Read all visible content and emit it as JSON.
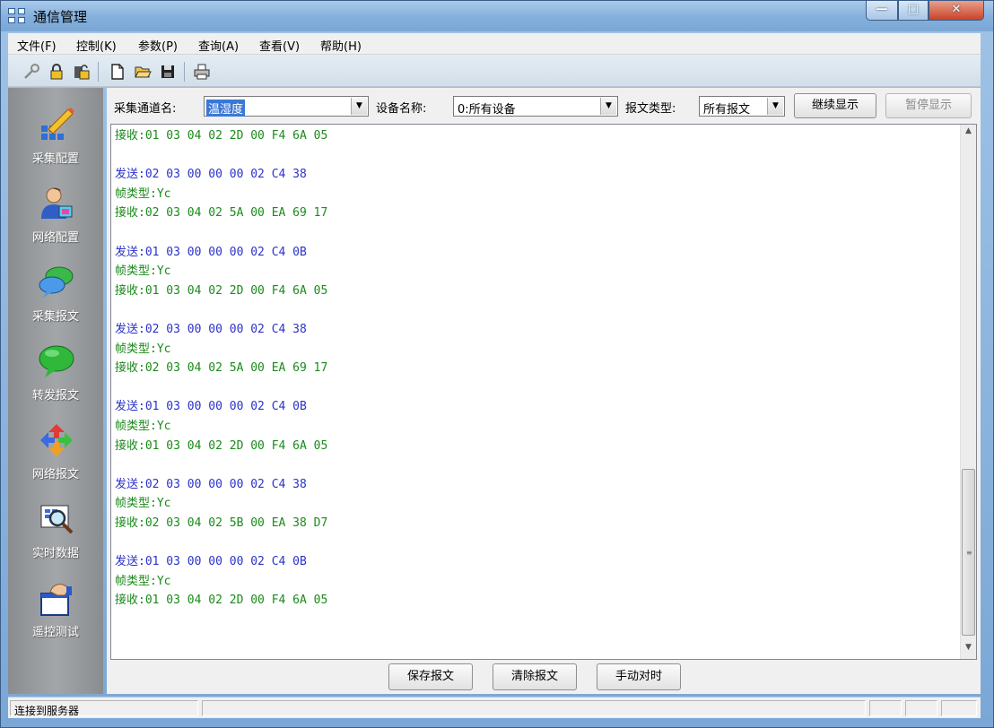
{
  "window": {
    "title": "通信管理"
  },
  "menu": [
    {
      "label": "文件(F)"
    },
    {
      "label": "控制(K)"
    },
    {
      "label": "参数(P)"
    },
    {
      "label": "查询(A)"
    },
    {
      "label": "查看(V)"
    },
    {
      "label": "帮助(H)"
    }
  ],
  "toolbar": {
    "icons": [
      "key-icon",
      "lock-icon",
      "unlock-icon",
      "new-file-icon",
      "open-folder-icon",
      "save-icon",
      "print-icon"
    ]
  },
  "sidebar": {
    "items": [
      {
        "label": "采集配置",
        "icon": "collect-config-icon"
      },
      {
        "label": "网络配置",
        "icon": "network-config-icon"
      },
      {
        "label": "采集报文",
        "icon": "collect-message-icon"
      },
      {
        "label": "转发报文",
        "icon": "forward-message-icon"
      },
      {
        "label": "网络报文",
        "icon": "network-message-icon"
      },
      {
        "label": "实时数据",
        "icon": "realtime-data-icon"
      },
      {
        "label": "遥控测试",
        "icon": "remote-control-icon"
      }
    ]
  },
  "filters": {
    "channel_label": "采集通道名:",
    "channel_value": "温湿度",
    "device_label": "设备名称:",
    "device_value": "0:所有设备",
    "type_label": "报文类型:",
    "type_value": "所有报文",
    "continue_button": "继续显示",
    "pause_button": "暂停显示"
  },
  "log": {
    "lines": [
      {
        "kind": "recv",
        "text": "接收:01 03 04 02 2D 00 F4 6A 05"
      },
      {
        "kind": "blank",
        "text": ""
      },
      {
        "kind": "send",
        "text": "发送:02 03 00 00 00 02 C4 38"
      },
      {
        "kind": "frame",
        "text": "帧类型:Yc"
      },
      {
        "kind": "recv",
        "text": "接收:02 03 04 02 5A 00 EA 69 17"
      },
      {
        "kind": "blank",
        "text": ""
      },
      {
        "kind": "send",
        "text": "发送:01 03 00 00 00 02 C4 0B"
      },
      {
        "kind": "frame",
        "text": "帧类型:Yc"
      },
      {
        "kind": "recv",
        "text": "接收:01 03 04 02 2D 00 F4 6A 05"
      },
      {
        "kind": "blank",
        "text": ""
      },
      {
        "kind": "send",
        "text": "发送:02 03 00 00 00 02 C4 38"
      },
      {
        "kind": "frame",
        "text": "帧类型:Yc"
      },
      {
        "kind": "recv",
        "text": "接收:02 03 04 02 5A 00 EA 69 17"
      },
      {
        "kind": "blank",
        "text": ""
      },
      {
        "kind": "send",
        "text": "发送:01 03 00 00 00 02 C4 0B"
      },
      {
        "kind": "frame",
        "text": "帧类型:Yc"
      },
      {
        "kind": "recv",
        "text": "接收:01 03 04 02 2D 00 F4 6A 05"
      },
      {
        "kind": "blank",
        "text": ""
      },
      {
        "kind": "send",
        "text": "发送:02 03 00 00 00 02 C4 38"
      },
      {
        "kind": "frame",
        "text": "帧类型:Yc"
      },
      {
        "kind": "recv",
        "text": "接收:02 03 04 02 5B 00 EA 38 D7"
      },
      {
        "kind": "blank",
        "text": ""
      },
      {
        "kind": "send",
        "text": "发送:01 03 00 00 00 02 C4 0B"
      },
      {
        "kind": "frame",
        "text": "帧类型:Yc"
      },
      {
        "kind": "recv",
        "text": "接收:01 03 04 02 2D 00 F4 6A 05"
      }
    ]
  },
  "actions": {
    "save_button": "保存报文",
    "clear_button": "清除报文",
    "sync_button": "手动对时"
  },
  "status": {
    "text": "连接到服务器"
  },
  "colors": {
    "send": "#2a32c8",
    "frame": "#1a8a1a",
    "recv": "#1a8a1a",
    "selection": "#3a78d6"
  }
}
